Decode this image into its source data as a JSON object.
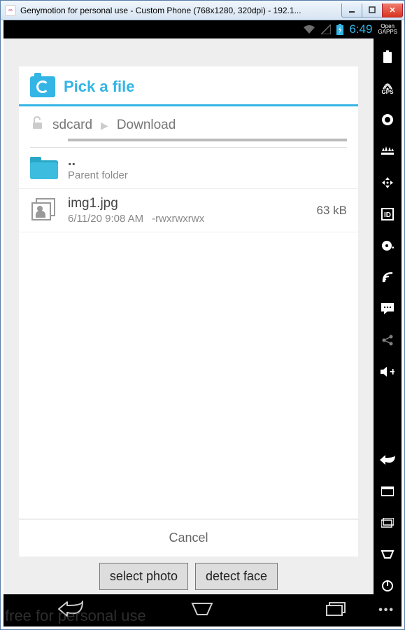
{
  "window": {
    "title": "Genymotion for personal use - Custom Phone (768x1280, 320dpi) - 192.1..."
  },
  "statusbar": {
    "time": "6:49",
    "opengapps": "Open\nGAPPS"
  },
  "dialog": {
    "title": "Pick a file",
    "breadcrumb": {
      "root": "sdcard",
      "current": "Download"
    },
    "parent": {
      "name": "..",
      "sub": "Parent folder"
    },
    "files": [
      {
        "name": "img1.jpg",
        "date": "6/11/20 9:08 AM",
        "perm": "-rwxrwxrwx",
        "size": "63 kB"
      }
    ],
    "cancel": "Cancel"
  },
  "bg": {
    "select_photo": "select photo",
    "detect_face": "detect face"
  },
  "watermark": "free for personal use"
}
